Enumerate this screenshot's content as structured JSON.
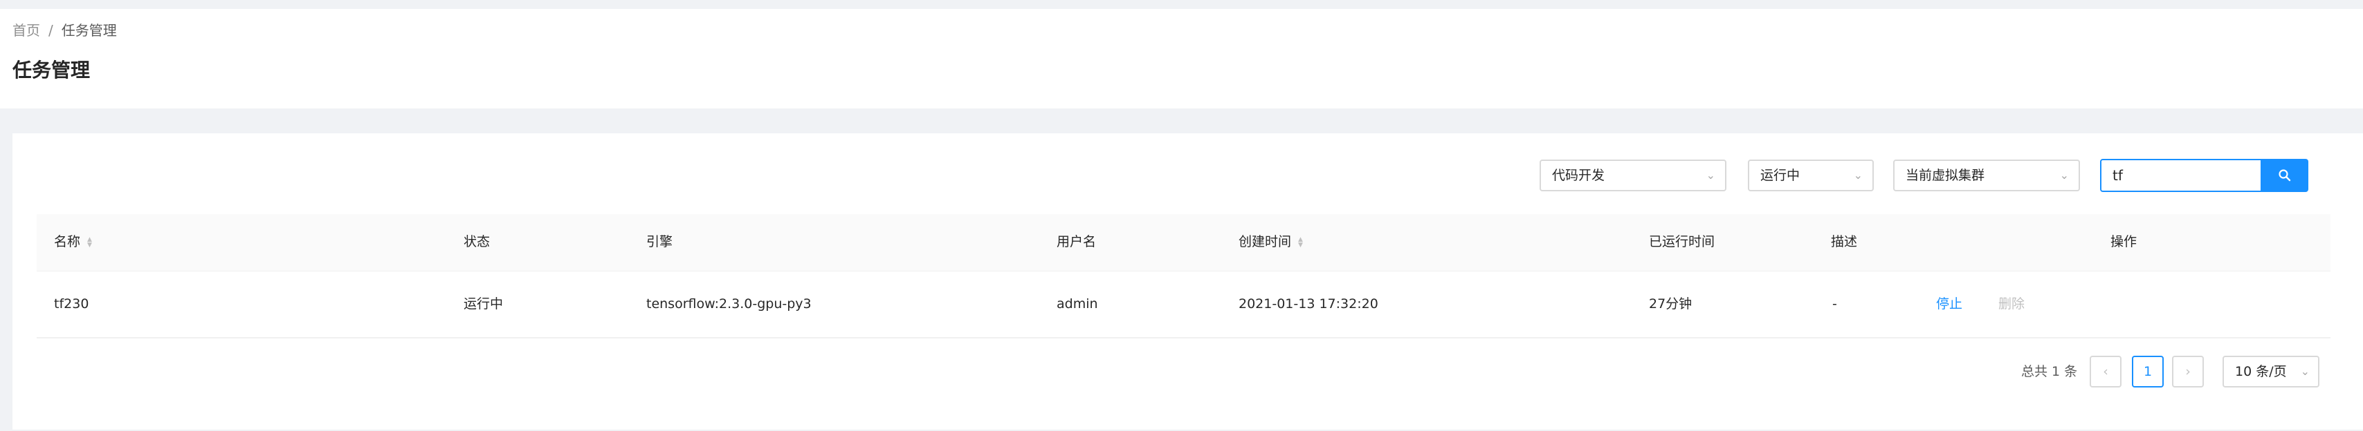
{
  "breadcrumb": {
    "home": "首页",
    "separator": "/",
    "current": "任务管理"
  },
  "page_title": "任务管理",
  "filters": {
    "type_select": "代码开发",
    "status_select": "运行中",
    "cluster_select": "当前虚拟集群",
    "search_value": "tf"
  },
  "table": {
    "columns": [
      "名称",
      "状态",
      "引擎",
      "用户名",
      "创建时间",
      "已运行时间",
      "描述",
      "操作"
    ],
    "rows": [
      {
        "name": "tf230",
        "status": "运行中",
        "engine": "tensorflow:2.3.0-gpu-py3",
        "user": "admin",
        "created": "2021-01-13 17:32:20",
        "elapsed": "27分钟",
        "description": "-",
        "actions": {
          "stop": "停止",
          "delete": "删除"
        }
      }
    ]
  },
  "pagination": {
    "total_text": "总共 1 条",
    "prev": "‹",
    "current_page": "1",
    "next": "›",
    "page_size": "10 条/页"
  },
  "colors": {
    "accent": "#1890ff",
    "background": "#f0f2f5"
  },
  "icons": {
    "search": "search-icon",
    "chevron": "chevron-down-icon",
    "sort": "sort-icon"
  }
}
